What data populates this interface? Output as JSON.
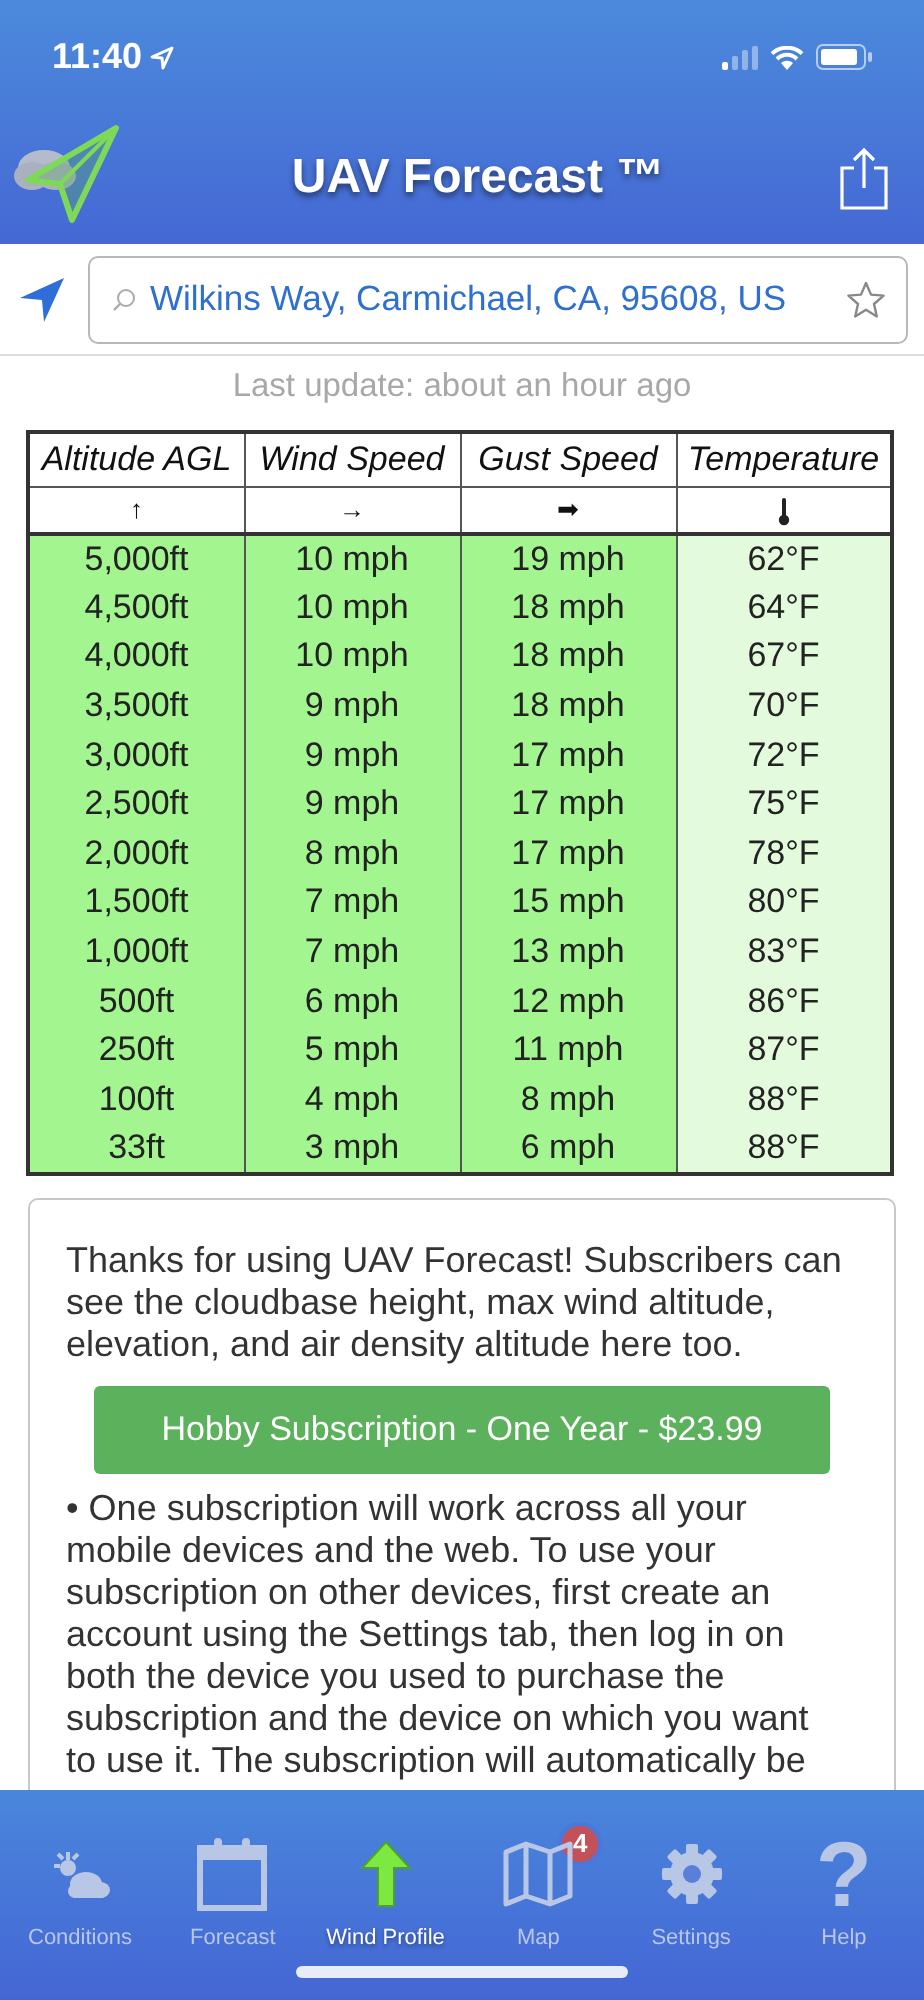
{
  "status_bar": {
    "time": "11:40"
  },
  "header": {
    "title": "UAV Forecast ™"
  },
  "search": {
    "value": "Wilkins Way, Carmichael, CA, 95608, US",
    "favorite": false
  },
  "last_update": "Last update: about an hour ago",
  "table": {
    "columns": [
      {
        "label": "Altitude AGL",
        "symbol": "↑"
      },
      {
        "label": "Wind Speed",
        "symbol": "→"
      },
      {
        "label": "Gust Speed",
        "symbol": "➡"
      },
      {
        "label": "Temperature"
      }
    ],
    "rows": [
      [
        "5,000ft",
        "10 mph",
        "19 mph",
        "62°F"
      ],
      [
        "4,500ft",
        "10 mph",
        "18 mph",
        "64°F"
      ],
      [
        "4,000ft",
        "10 mph",
        "18 mph",
        "67°F"
      ],
      [
        "3,500ft",
        "9 mph",
        "18 mph",
        "70°F"
      ],
      [
        "3,000ft",
        "9 mph",
        "17 mph",
        "72°F"
      ],
      [
        "2,500ft",
        "9 mph",
        "17 mph",
        "75°F"
      ],
      [
        "2,000ft",
        "8 mph",
        "17 mph",
        "78°F"
      ],
      [
        "1,500ft",
        "7 mph",
        "15 mph",
        "80°F"
      ],
      [
        "1,000ft",
        "7 mph",
        "13 mph",
        "83°F"
      ],
      [
        "500ft",
        "6 mph",
        "12 mph",
        "86°F"
      ],
      [
        "250ft",
        "5 mph",
        "11 mph",
        "87°F"
      ],
      [
        "100ft",
        "4 mph",
        "8 mph",
        "88°F"
      ],
      [
        "33ft",
        "3 mph",
        "6 mph",
        "88°F"
      ]
    ]
  },
  "promo": {
    "intro": "Thanks for using UAV Forecast! Subscribers can see the cloudbase height, max wind altitude, elevation, and air density altitude here too.",
    "button": "Hobby Subscription - One Year - $23.99",
    "note": "• One subscription will work across all your mobile devices and the web. To use your subscription on other devices, first create an account using the Settings tab, then log in on both the device you used to purchase the subscription and the device on which you want to use it. The subscription will automatically be"
  },
  "tabs": [
    {
      "label": "Conditions",
      "selected": false
    },
    {
      "label": "Forecast",
      "selected": false
    },
    {
      "label": "Wind Profile",
      "selected": true
    },
    {
      "label": "Map",
      "selected": false,
      "badge": "4"
    },
    {
      "label": "Settings",
      "selected": false
    },
    {
      "label": "Help",
      "glyph": "?",
      "selected": false
    }
  ]
}
